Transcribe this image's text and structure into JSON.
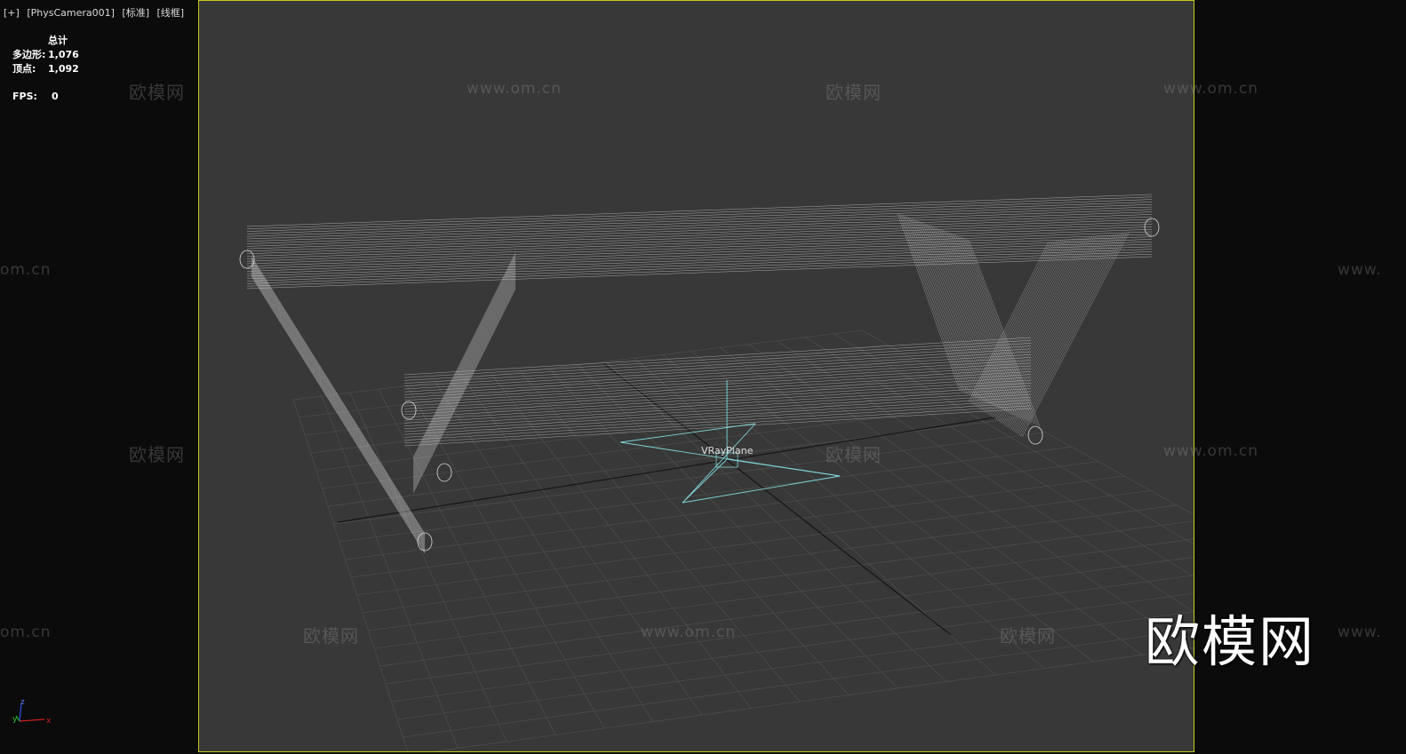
{
  "viewport": {
    "labels": [
      "[+]",
      "[PhysCamera001]",
      "[标准]",
      "[线框]"
    ]
  },
  "stats": {
    "header": "总计",
    "rows": [
      {
        "label": "多边形:",
        "value": "1,076"
      },
      {
        "label": "顶点:",
        "value": "1,092"
      }
    ],
    "fps_label": "FPS:",
    "fps_value": "0"
  },
  "scene": {
    "object_label": "VRayPlane",
    "wireframe_color": "#d8d8d8",
    "helper_color": "#7fd4d4",
    "grid_color": "#4c4c4c",
    "frame_color": "#c8c81e"
  },
  "watermarks": {
    "brand_text": "欧模网",
    "url_text": "www.om.cn",
    "url_partial_left": "om.cn",
    "url_partial_right": "www."
  },
  "axis": {
    "x": "x",
    "y": "y",
    "z": "z"
  }
}
